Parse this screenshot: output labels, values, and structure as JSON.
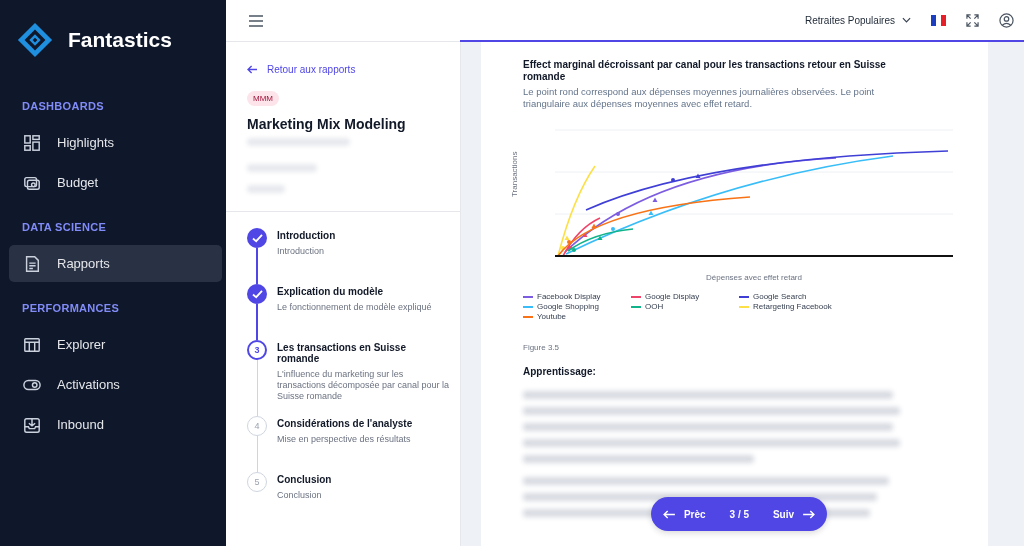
{
  "brand": {
    "name": "Fantastics"
  },
  "sidebar": {
    "sections": [
      {
        "title": "DASHBOARDS",
        "items": [
          {
            "label": "Highlights",
            "selected": false
          },
          {
            "label": "Budget",
            "selected": false
          }
        ]
      },
      {
        "title": "DATA SCIENCE",
        "items": [
          {
            "label": "Rapports",
            "selected": true
          }
        ]
      },
      {
        "title": "PERFORMANCES",
        "items": [
          {
            "label": "Explorer",
            "selected": false
          },
          {
            "label": "Activations",
            "selected": false
          },
          {
            "label": "Inbound",
            "selected": false
          }
        ]
      }
    ]
  },
  "topbar": {
    "organization": "Retraites Populaires"
  },
  "report": {
    "back_link": "Retour aux rapports",
    "tag": "MMM",
    "title": "Marketing Mix Modeling"
  },
  "steps": [
    {
      "title": "Introduction",
      "subtitle": "Introduction",
      "completed": true,
      "selected": false
    },
    {
      "title": "Explication du modèle",
      "subtitle": "Le fonctionnement de modèle expliqué",
      "completed": true,
      "selected": false
    },
    {
      "number": "3",
      "title": "Les transactions en Suisse romande",
      "subtitle": "L'influence du marketing sur les transactions décomposée par canal pour la Suisse romande",
      "completed": false,
      "selected": true
    },
    {
      "number": "4",
      "title": "Considérations de l'analyste",
      "subtitle": "Mise en perspective des résultats",
      "completed": false,
      "selected": false
    },
    {
      "number": "5",
      "title": "Conclusion",
      "subtitle": "Conclusion",
      "completed": false,
      "selected": false
    }
  ],
  "figure": {
    "title": "Effect marginal décroissant par canal pour les transactions retour en Suisse romande",
    "description": "Le point rond correspond aux dépenses moyennes journalières observées. Le point triangulaire aux dépenses moyennes avec effet retard.",
    "ylabel": "Transactions",
    "xlabel": "Dépenses avec effet retard",
    "legend": [
      {
        "name": "Facebook Display",
        "color": "#7c5ce0"
      },
      {
        "name": "Google Display",
        "color": "#f0436a"
      },
      {
        "name": "Google Search",
        "color": "#3f3fd6"
      },
      {
        "name": "Google Shopping",
        "color": "#38bdf8"
      },
      {
        "name": "OOH",
        "color": "#10b38a"
      },
      {
        "name": "Retargeting Facebook",
        "color": "#fde047"
      },
      {
        "name": "Youtube",
        "color": "#f97316"
      }
    ],
    "caption": "Figure 3.5"
  },
  "section_heading": "Apprentissage:",
  "pager": {
    "previous": "Prèc",
    "position": "3 / 5",
    "next": "Suiv"
  }
}
